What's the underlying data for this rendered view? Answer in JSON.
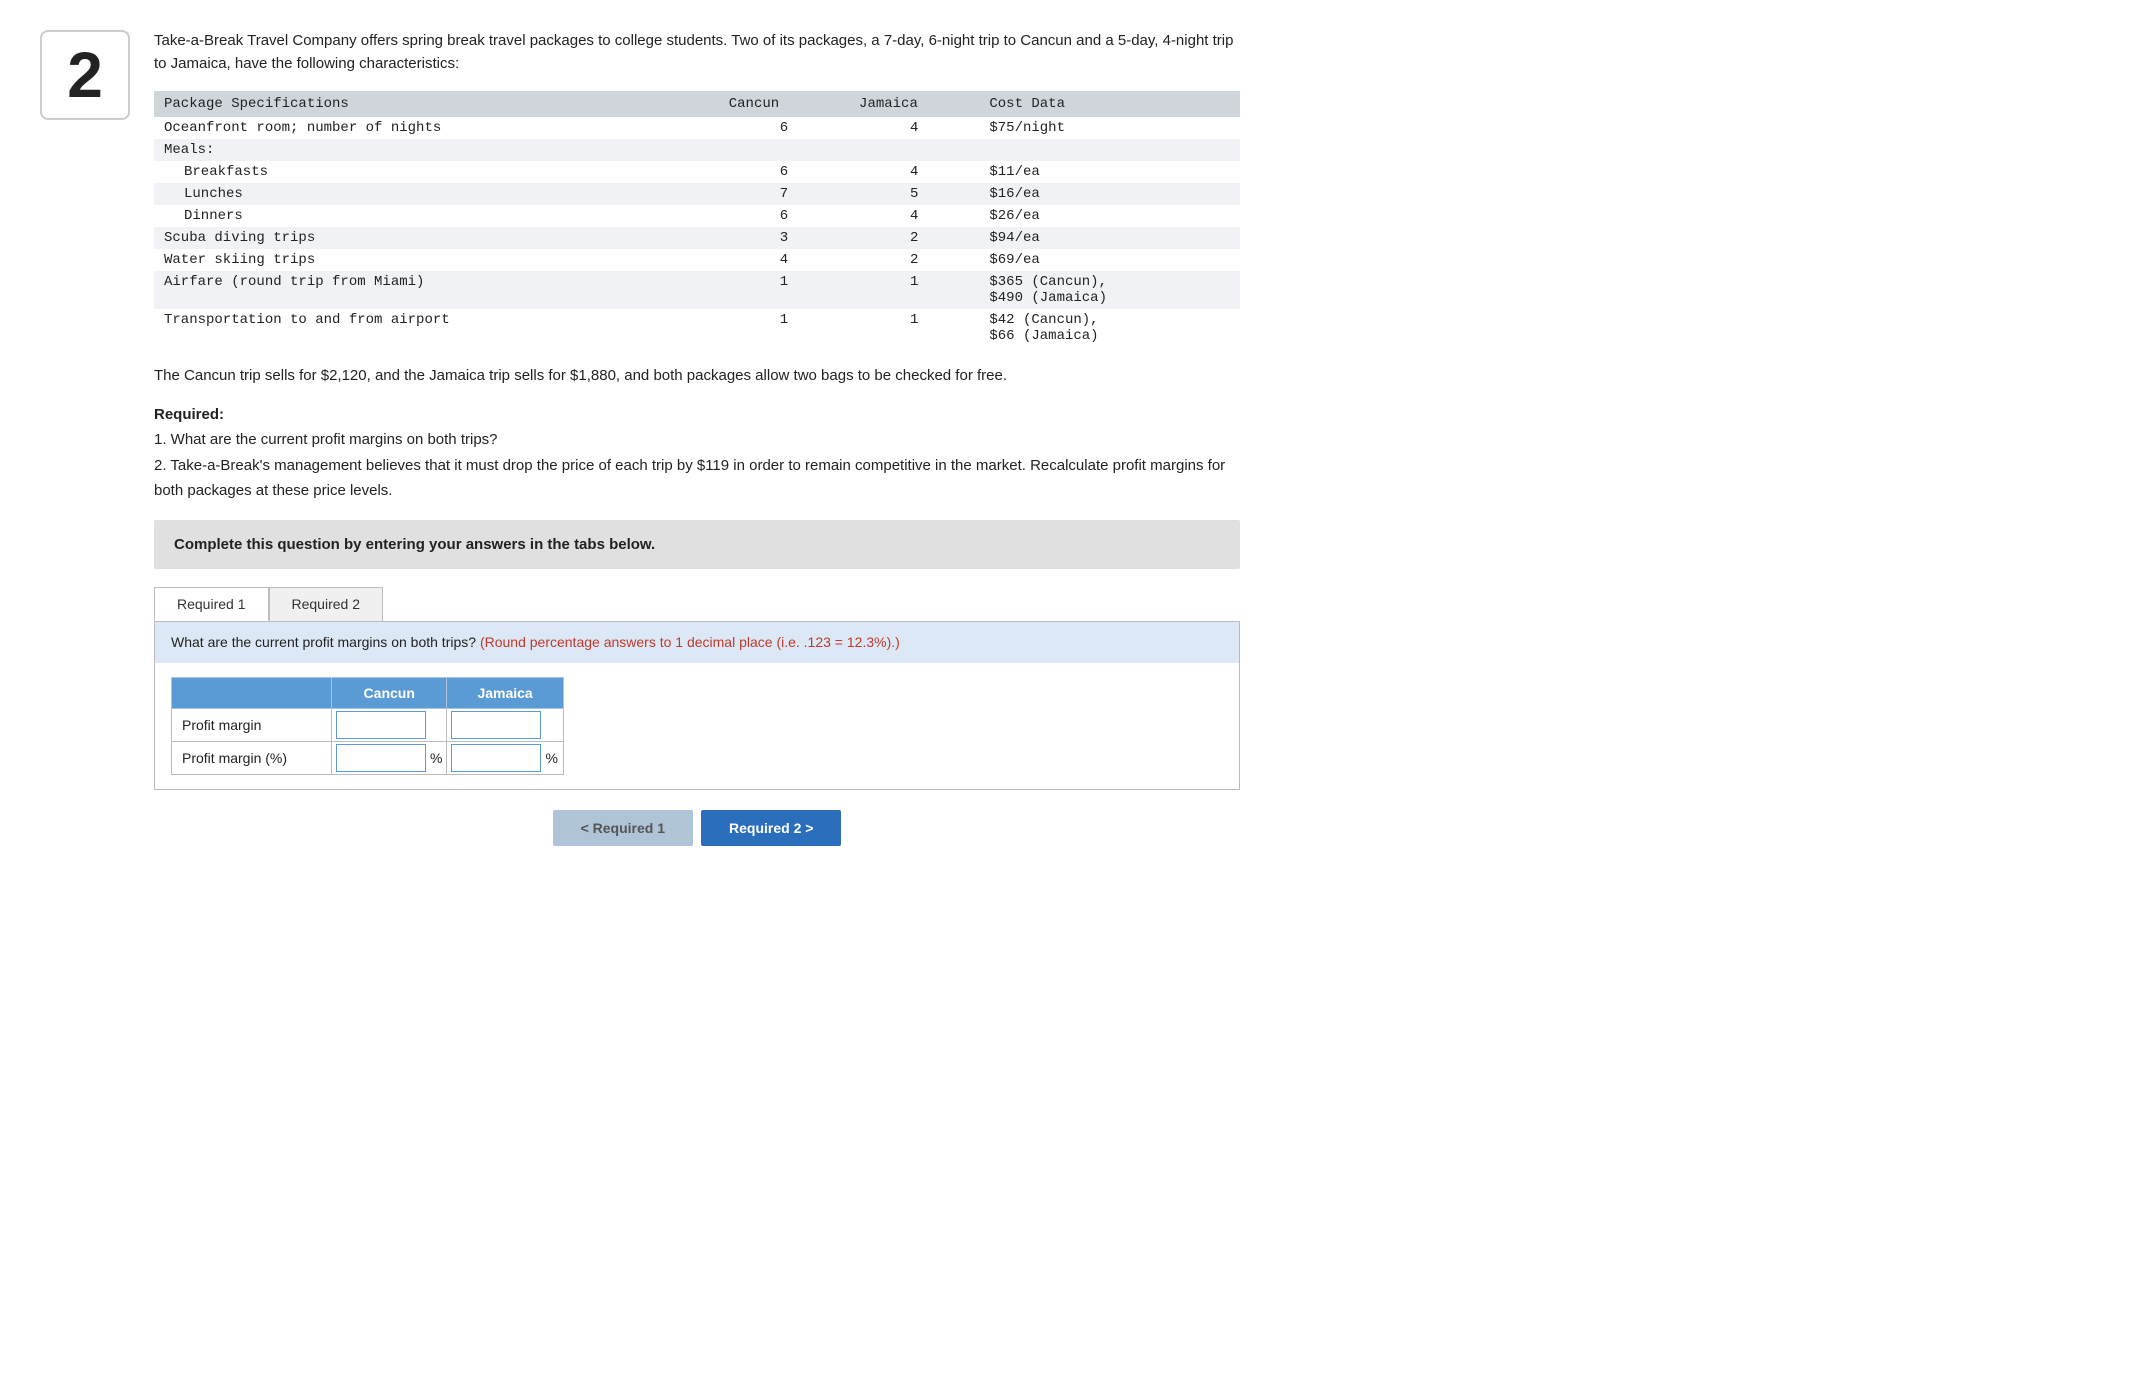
{
  "question": {
    "number": "2",
    "intro": "Take-a-Break Travel Company offers spring break travel packages to college students. Two of its packages, a 7-day, 6-night trip to Cancun and a 5-day, 4-night trip to Jamaica, have the following characteristics:",
    "table": {
      "headers": [
        "Package Specifications",
        "Cancun",
        "Jamaica",
        "Cost Data"
      ],
      "rows": [
        {
          "spec": "Oceanfront room; number of nights",
          "cancun": "6",
          "jamaica": "4",
          "cost": "$75/night",
          "indent": 0
        },
        {
          "spec": "Meals:",
          "cancun": "",
          "jamaica": "",
          "cost": "",
          "indent": 0
        },
        {
          "spec": "Breakfasts",
          "cancun": "6",
          "jamaica": "4",
          "cost": "$11/ea",
          "indent": 1
        },
        {
          "spec": "Lunches",
          "cancun": "7",
          "jamaica": "5",
          "cost": "$16/ea",
          "indent": 1
        },
        {
          "spec": "Dinners",
          "cancun": "6",
          "jamaica": "4",
          "cost": "$26/ea",
          "indent": 1
        },
        {
          "spec": "Scuba diving trips",
          "cancun": "3",
          "jamaica": "2",
          "cost": "$94/ea",
          "indent": 0
        },
        {
          "spec": "Water skiing trips",
          "cancun": "4",
          "jamaica": "2",
          "cost": "$69/ea",
          "indent": 0
        },
        {
          "spec": "Airfare (round trip from Miami)",
          "cancun": "1",
          "jamaica": "1",
          "cost": "$365 (Cancun),\n$490 (Jamaica)",
          "indent": 0
        },
        {
          "spec": "Transportation to and from airport",
          "cancun": "1",
          "jamaica": "1",
          "cost": "$42 (Cancun),\n$66 (Jamaica)",
          "indent": 0
        }
      ]
    },
    "summary": "The Cancun trip sells for $2,120, and the Jamaica trip sells for $1,880, and both packages allow two bags to be checked for free.",
    "required_label": "Required:",
    "required_items": [
      "1. What are the current profit margins on both trips?",
      "2. Take-a-Break's management believes that it must drop the price of each trip by $119 in order to remain competitive in the market. Recalculate profit margins for both packages at these price levels."
    ]
  },
  "complete_box": {
    "text": "Complete this question by entering your answers in the tabs below."
  },
  "tabs": [
    {
      "id": "req1",
      "label": "Required 1",
      "active": true
    },
    {
      "id": "req2",
      "label": "Required 2",
      "active": false
    }
  ],
  "tab1": {
    "instruction": "What are the current profit margins on both trips?",
    "round_note": "(Round percentage answers to 1 decimal place (i.e. .123 = 12.3%).)",
    "table_headers": [
      "",
      "Cancun",
      "Jamaica"
    ],
    "rows": [
      {
        "label": "Profit margin",
        "cancun_value": "",
        "jamaica_value": "",
        "has_pct": false
      },
      {
        "label": "Profit margin (%)",
        "cancun_value": "",
        "jamaica_value": "",
        "has_pct": true
      }
    ]
  },
  "nav": {
    "prev_label": "Required 1",
    "next_label": "Required 2",
    "prev_arrow": "<",
    "next_arrow": ">"
  }
}
